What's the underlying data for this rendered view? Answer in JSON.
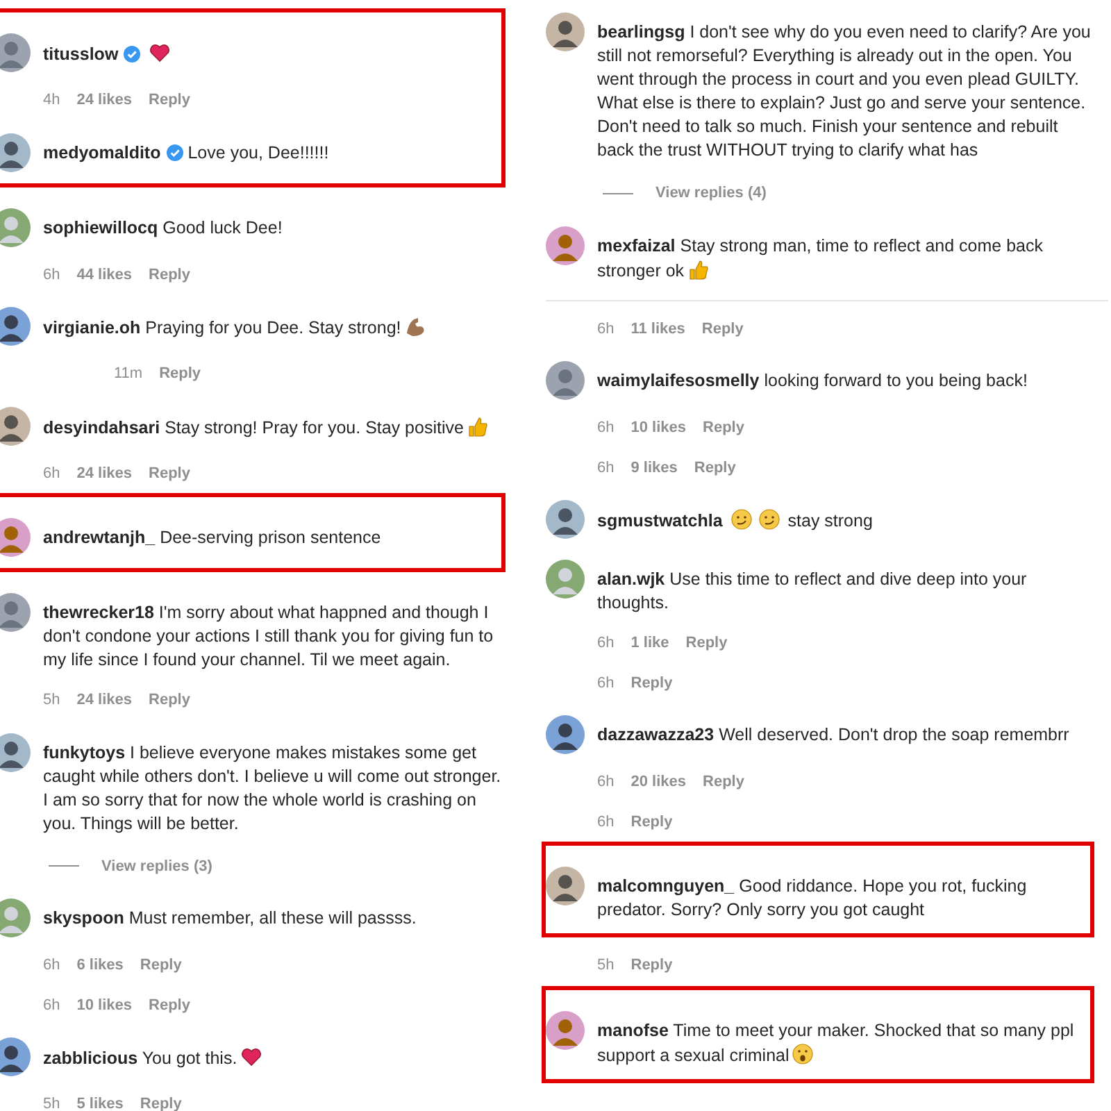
{
  "columns": [
    {
      "items": [
        {
          "kind": "highlight",
          "items": [
            {
              "kind": "comment",
              "user": "titusslow",
              "verified": true,
              "icons_after": [
                {
                  "kind": "heart"
                }
              ]
            },
            {
              "kind": "meta",
              "time": "4h",
              "likes": "24 likes",
              "reply": "Reply"
            },
            {
              "kind": "comment",
              "user": "medyomaldito",
              "verified": true,
              "text": "Love you, Dee!!!!!!"
            }
          ]
        },
        {
          "kind": "comment",
          "user": "sophiewillocq",
          "verified": false,
          "text": "Good luck Dee!"
        },
        {
          "kind": "meta",
          "time": "6h",
          "likes": "44 likes",
          "reply": "Reply"
        },
        {
          "kind": "comment",
          "user": "virgianie.oh",
          "verified": false,
          "text": "Praying for you Dee. Stay strong!",
          "icons_after": [
            {
              "kind": "muscle"
            }
          ]
        },
        {
          "kind": "reply_meta",
          "time": "11m",
          "reply": "Reply"
        },
        {
          "kind": "comment",
          "user": "desyindahsari",
          "verified": false,
          "text": "Stay strong! Pray for you. Stay positive",
          "icons_after": [
            {
              "kind": "thumbs"
            }
          ]
        },
        {
          "kind": "meta",
          "time": "6h",
          "likes": "24 likes",
          "reply": "Reply"
        },
        {
          "kind": "highlight",
          "items": [
            {
              "kind": "comment",
              "user": "andrewtanjh_",
              "verified": false,
              "text": "Dee-serving prison sentence"
            }
          ]
        },
        {
          "kind": "comment",
          "user": "thewrecker18",
          "verified": false,
          "text": "I'm sorry about what happned and though I don't condone your actions I still thank you for giving fun to my life since I found your channel. Til we meet again."
        },
        {
          "kind": "meta",
          "time": "5h",
          "likes": "24 likes",
          "reply": "Reply"
        },
        {
          "kind": "comment",
          "user": "funkytoys",
          "verified": false,
          "text": "I believe everyone makes mistakes some get caught while others don't. I believe u will come out stronger. I am so sorry that for now the whole world is crashing on you. Things will be better."
        },
        {
          "kind": "view_replies",
          "label": "View replies (3)"
        },
        {
          "kind": "comment",
          "user": "skyspoon",
          "verified": false,
          "text": "Must remember, all these will passss."
        },
        {
          "kind": "meta",
          "time": "6h",
          "likes": "6 likes",
          "reply": "Reply"
        },
        {
          "kind": "meta",
          "time": "6h",
          "likes": "10 likes",
          "reply": "Reply"
        },
        {
          "kind": "comment",
          "user": "zabblicious",
          "verified": false,
          "text": "You got this.",
          "icons_after": [
            {
              "kind": "heart"
            }
          ]
        },
        {
          "kind": "meta",
          "time": "5h",
          "likes": "5 likes",
          "reply": "Reply"
        }
      ]
    },
    {
      "items": [
        {
          "kind": "comment",
          "user": "bearlingsg",
          "verified": false,
          "text": "I don't see why do you even need to clarify? Are you still not remorseful? Everything is already out in the open. You went through the process in court and you even plead GUILTY. What else is there to explain? Just go and serve your sentence. Don't need to talk so much. Finish your sentence and rebuilt back the trust WITHOUT trying to clarify what has"
        },
        {
          "kind": "view_replies",
          "label": "View replies (4)"
        },
        {
          "kind": "comment",
          "user": "mexfaizal",
          "verified": false,
          "text": "Stay strong man, time to reflect and come back stronger ok",
          "icons_after": [
            {
              "kind": "thumbs"
            }
          ]
        },
        {
          "kind": "divider"
        },
        {
          "kind": "meta",
          "time": "6h",
          "likes": "11 likes",
          "reply": "Reply"
        },
        {
          "kind": "comment",
          "user": "waimylaifesosmelly",
          "verified": false,
          "text": "looking forward to you being back!"
        },
        {
          "kind": "meta",
          "time": "6h",
          "likes": "10 likes",
          "reply": "Reply"
        },
        {
          "kind": "meta",
          "time": "6h",
          "likes": "9 likes",
          "reply": "Reply"
        },
        {
          "kind": "comment",
          "user": "sgmustwatchla",
          "verified": false,
          "icons_before": [
            {
              "kind": "smirk"
            },
            {
              "kind": "smirk"
            }
          ],
          "text": "stay strong"
        },
        {
          "kind": "comment",
          "user": "alan.wjk",
          "verified": false,
          "text": "Use this time to reflect and dive deep into your thoughts."
        },
        {
          "kind": "meta",
          "time": "6h",
          "likes": "1 like",
          "reply": "Reply"
        },
        {
          "kind": "meta",
          "time": "6h",
          "reply": "Reply"
        },
        {
          "kind": "comment",
          "user": "dazzawazza23",
          "verified": false,
          "text": "Well deserved. Don't drop the soap remembrr"
        },
        {
          "kind": "meta",
          "time": "6h",
          "likes": "20 likes",
          "reply": "Reply"
        },
        {
          "kind": "meta",
          "time": "6h",
          "reply": "Reply"
        },
        {
          "kind": "highlight",
          "items": [
            {
              "kind": "comment",
              "user": "malcomnguyen_",
              "verified": false,
              "text": "Good riddance. Hope you rot, fucking predator. Sorry? Only sorry you got caught"
            }
          ]
        },
        {
          "kind": "meta",
          "time": "5h",
          "reply": "Reply"
        },
        {
          "kind": "highlight",
          "items": [
            {
              "kind": "comment",
              "user": "manofse",
              "verified": false,
              "text": "Time to meet your maker. Shocked that so many ppl support a sexual criminal",
              "icons_after": [
                {
                  "kind": "surprised"
                }
              ]
            }
          ]
        }
      ]
    }
  ]
}
